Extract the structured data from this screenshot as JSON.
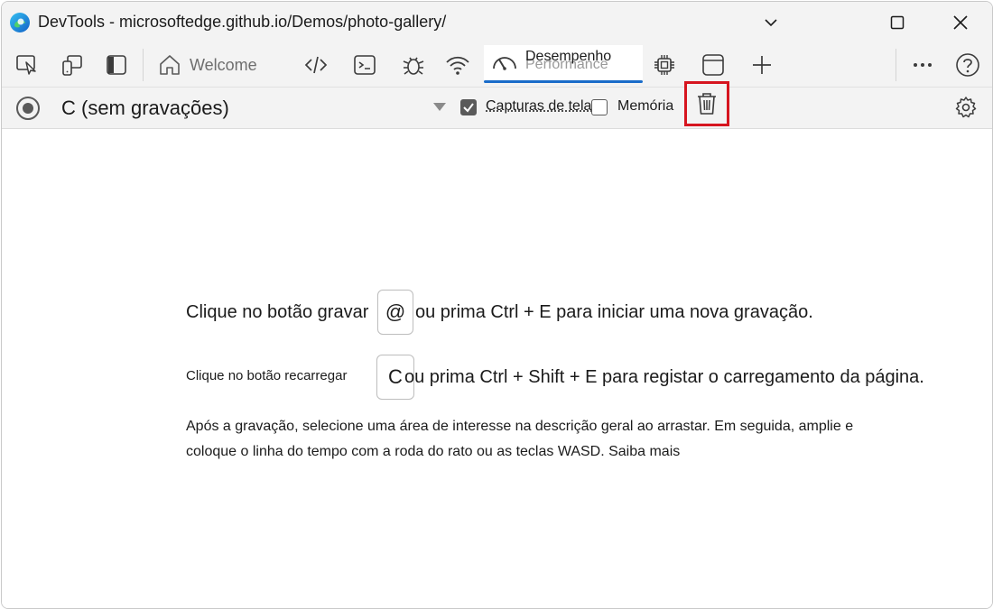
{
  "window": {
    "title": "DevTools - microsoftedge.github.io/Demos/photo-gallery/"
  },
  "tabs": {
    "welcome_label": "Welcome",
    "performance_label": "Desempenho",
    "performance_ghost_label": "Performance"
  },
  "toolbar": {
    "recording_select": "C (sem gravações)",
    "screenshots_label": "Capturas de tela",
    "screenshots_checked": true,
    "memory_label": "Memória",
    "memory_checked": false
  },
  "content": {
    "line1_prefix": "Clique no botão gravar",
    "record_key": "@",
    "line1_suffix": "ou prima Ctrl + E para iniciar uma nova gravação.",
    "line2_prefix": "Clique no botão recarregar",
    "reload_key": "C",
    "line2_suffix": "ou prima Ctrl + Shift + E para registar o carregamento da página.",
    "paragraph": "Após a gravação, selecione uma área de interesse na descrição geral ao arrastar. Em seguida, amplie e coloque o linha do tempo com a roda do rato ou as teclas WASD. Saiba mais"
  },
  "icons": [
    "edge-logo-icon",
    "chevron-down-icon",
    "maximize-icon",
    "close-icon",
    "inspect-icon",
    "device-emulation-icon",
    "dock-sidebar-icon",
    "home-icon",
    "code-icon",
    "console-icon",
    "bug-icon",
    "wifi-icon",
    "gauge-icon",
    "chip-icon",
    "application-icon",
    "plus-icon",
    "more-icon",
    "help-icon",
    "record-icon",
    "trash-icon",
    "gear-icon"
  ],
  "colors": {
    "accent": "#1a6cc9",
    "highlight_border": "#d6151f",
    "chrome_bg": "#f3f3f3"
  }
}
